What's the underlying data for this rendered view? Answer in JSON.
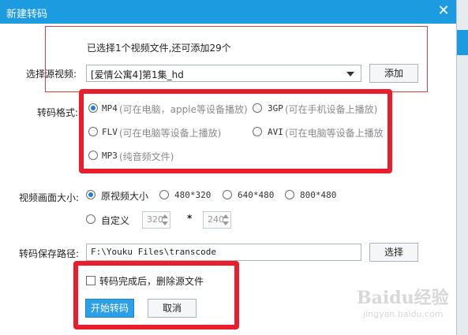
{
  "window": {
    "title": "新建转码"
  },
  "status": {
    "selected_text": "已选择1个视频文件,还可添加29个"
  },
  "source": {
    "label": "选择源视频:",
    "value": "[爱情公寓4]第1集_hd",
    "add_label": "添加"
  },
  "format": {
    "label": "转码格式:",
    "options": [
      {
        "name": "MP4",
        "desc": "(可在电脑，apple等设备播放)",
        "checked": true
      },
      {
        "name": "3GP",
        "desc": "(可在手机设备上播放)",
        "checked": false
      },
      {
        "name": "FLV",
        "desc": "(可在电脑等设备上播放)",
        "checked": false
      },
      {
        "name": "AVI",
        "desc": "(可在电脑等设备上播放",
        "checked": false
      },
      {
        "name": "MP3",
        "desc": "(纯音频文件)",
        "checked": false
      }
    ]
  },
  "size": {
    "label": "视频画面大小:",
    "options": [
      {
        "text": "原视频大小",
        "checked": true
      },
      {
        "text": "480*320",
        "checked": false
      },
      {
        "text": "640*480",
        "checked": false
      },
      {
        "text": "800*480",
        "checked": false
      }
    ],
    "custom_label": "自定义",
    "width": "320",
    "times": "*",
    "height": "240"
  },
  "path": {
    "label": "转码保存路径:",
    "value": "F:\\Youku Files\\transcode",
    "choose_label": "选择"
  },
  "delete_source": {
    "label": "转码完成后，删除源文件",
    "checked": false
  },
  "actions": {
    "start_label": "开始转码",
    "cancel_label": "取消"
  },
  "watermark": {
    "brand": "Baidu经验",
    "url": "jingyan.baidu.com"
  },
  "colors": {
    "accent": "#1c9be0",
    "highlight": "#ea1d2c"
  },
  "icons": {
    "close": "close-icon",
    "dropdown": "chevron-down-icon"
  }
}
